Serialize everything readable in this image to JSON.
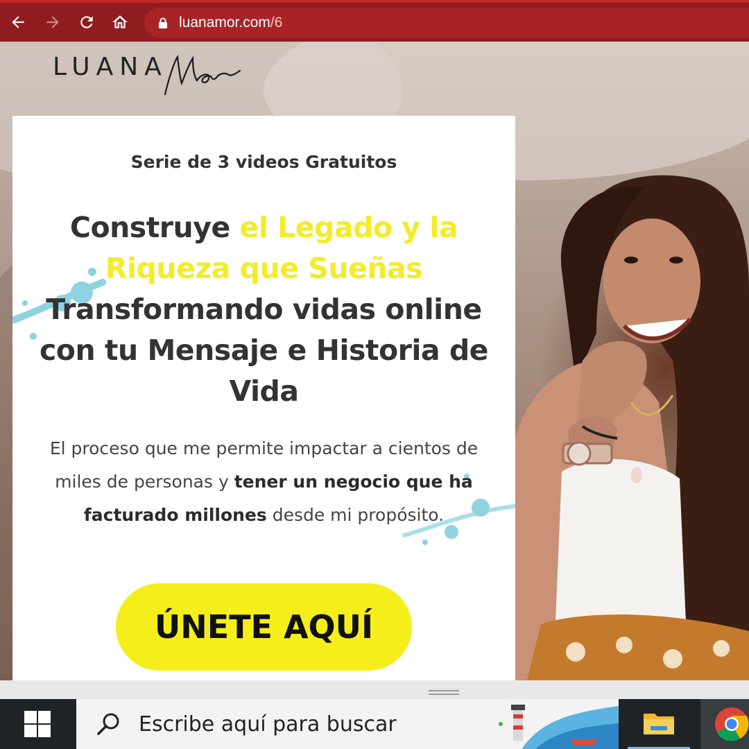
{
  "browser": {
    "back_icon": "arrow-left-icon",
    "forward_icon": "arrow-right-icon",
    "reload_icon": "reload-icon",
    "home_icon": "home-icon",
    "lock_icon": "lock-icon",
    "url_host": "luanamor.com",
    "url_path": "/6",
    "toolbar_color": "#8f1d1f"
  },
  "logo": {
    "text": "LUANA",
    "script": "Mor"
  },
  "card": {
    "kicker": "Serie de 3 videos Gratuitos",
    "headline_lead": "Construye ",
    "headline_highlight": "el Legado y la Riqueza que Sueñas",
    "headline_rest": "Transformando vidas online con tu Mensaje e Historia de Vida",
    "body_lead": "El proceso que me permite impactar a cientos de miles de personas y ",
    "body_bold": "tener un negocio que ha facturado millones",
    "body_tail": " desde mi propósito.",
    "cta_label": "ÚNETE AQUÍ",
    "highlight_color": "#f2ec2a",
    "cta_color": "#f5ee1a"
  },
  "taskbar": {
    "start_icon": "windows-logo-icon",
    "search_icon": "search-icon",
    "search_placeholder": "Escribe aquí para buscar",
    "apps": [
      "file-explorer-icon",
      "chrome-icon"
    ]
  }
}
